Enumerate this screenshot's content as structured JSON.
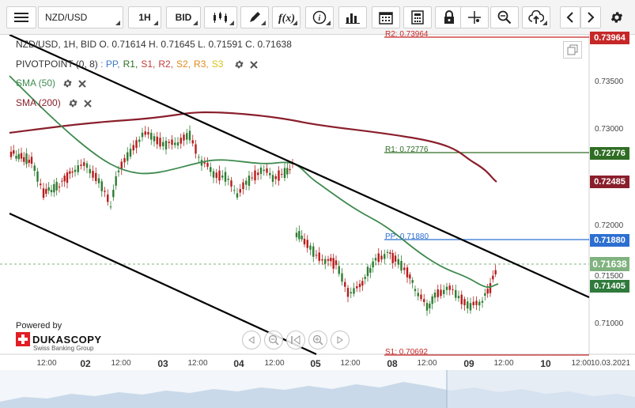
{
  "toolbar": {
    "symbol": "NZD/USD",
    "timeframe": "1H",
    "price_side": "BID",
    "icons": [
      "menu-icon",
      "candles-icon",
      "draw-icon",
      "fx-icon",
      "info-icon",
      "bar-chart-icon",
      "calendar-icon",
      "calculator-icon",
      "lock-icon",
      "crosshair-icon",
      "zoom-icon",
      "upload-icon",
      "chevron-left-icon",
      "chevron-right-icon",
      "gear-icon"
    ]
  },
  "legend": {
    "ohlc": "NZD/USD, 1H, BID   O. 0.71614 H. 0.71645 L. 0.71591 C. 0.71638",
    "pivot_label": "PIVOTPOINT (0, 8)",
    "pivot_items": [
      {
        "text": ": PP,",
        "color": "#3a78c9"
      },
      {
        "text": "R1,",
        "color": "#2f6d23"
      },
      {
        "text": "S1,",
        "color": "#c23b3b"
      },
      {
        "text": "R2,",
        "color": "#c23b3b"
      },
      {
        "text": "S2,",
        "color": "#e08a1e"
      },
      {
        "text": "R3,",
        "color": "#e08a1e"
      },
      {
        "text": "S3",
        "color": "#d6c21a"
      }
    ],
    "sma50_label": "SMA (50)",
    "sma200_label": "SMA (200)"
  },
  "axis": {
    "y_ticks": [
      "0.73500",
      "0.73000",
      "0.72000",
      "0.71500",
      "0.71000"
    ],
    "x_ticks": [
      {
        "label": "12:00",
        "day": false
      },
      {
        "label": "02",
        "day": true
      },
      {
        "label": "12:00",
        "day": false
      },
      {
        "label": "03",
        "day": true
      },
      {
        "label": "12:00",
        "day": false
      },
      {
        "label": "04",
        "day": true
      },
      {
        "label": "12:00",
        "day": false
      },
      {
        "label": "05",
        "day": true
      },
      {
        "label": "12:00",
        "day": false
      },
      {
        "label": "08",
        "day": true
      },
      {
        "label": "12:00",
        "day": false
      },
      {
        "label": "09",
        "day": true
      },
      {
        "label": "12:00",
        "day": false
      },
      {
        "label": "10",
        "day": true
      },
      {
        "label": "12:00",
        "day": false
      },
      {
        "label": "10.03.2021",
        "day": false
      }
    ]
  },
  "price_boxes": [
    {
      "text": "0.73964",
      "color": "#c62828"
    },
    {
      "text": "0.72776",
      "color": "#2f6d23"
    },
    {
      "text": "0.72485",
      "color": "#8a1f2c"
    },
    {
      "text": "0.71880",
      "color": "#2d6fd1"
    },
    {
      "text": "0.71638",
      "color": "#7fb27f"
    },
    {
      "text": "0.71405",
      "color": "#2f7a3c"
    }
  ],
  "pivot_lines": [
    {
      "label": "R2: 0.73964",
      "color": "#c62828"
    },
    {
      "label": "R1: 0.72776",
      "color": "#2f6d23"
    },
    {
      "label": "PP: 0.71880",
      "color": "#2d6fd1"
    },
    {
      "label": "S1: 0.70692",
      "color": "#c62828"
    }
  ],
  "branding": {
    "powered": "Powered by",
    "name": "DUKASCOPY",
    "sub": "Swiss Banking Group"
  },
  "colors": {
    "candle_up": "#2e7d32",
    "candle_down": "#b71c1c",
    "sma50": "#3f8a4f",
    "sma200": "#8a1f2c",
    "trendline": "#000000"
  }
}
